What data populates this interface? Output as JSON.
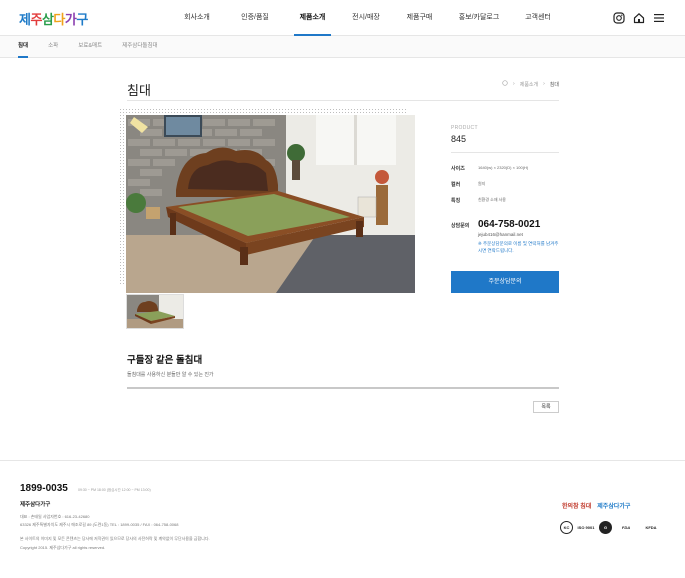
{
  "header": {
    "logo_text": "제주삼다가구",
    "nav": [
      "회사소개",
      "인증/품질",
      "제품소개",
      "전시/매장",
      "제품구매",
      "홍보/카달로그",
      "고객센터"
    ],
    "active_nav": "제품소개",
    "icons": [
      "instagram-icon",
      "home-icon",
      "menu-icon"
    ]
  },
  "subnav": {
    "tabs": [
      "침대",
      "소파",
      "보료&매트",
      "제주삼다돌침대"
    ],
    "active": "침대"
  },
  "page": {
    "title": "침대",
    "breadcrumb": [
      "제품소개",
      "침대"
    ]
  },
  "product": {
    "label": "PRODUCT",
    "code": "845",
    "specs": [
      {
        "key": "사이즈",
        "value": "1640(w) × 2320(D) × 100(H)"
      },
      {
        "key": "컬러",
        "value": "원지"
      },
      {
        "key": "특징",
        "value": "친환경 소재 사용"
      }
    ],
    "consult_label": "상담문의",
    "phone": "064-758-0021",
    "email": "jejub416@hanmail.net",
    "note": "※ 주문상담문의로 이름 및 연락처를 남겨주시면 연락드립니다.",
    "inquiry_button": "주문상담문의"
  },
  "description": {
    "title": "구들장 같은 돌침대",
    "text": "돌침대를 사용하신 분들만 알 수 있는 진가"
  },
  "list_button": "목록",
  "footer": {
    "phone": "1899-0035",
    "hours": "09:30 ~ PM 18:00 (점심시간 12:00 ~ PM 13:00)",
    "company": "제주삼다가구",
    "lines": [
      "대표 : 손태일  사업자번호 : 616-23-42680",
      "63326 제주특별자치도 제주시 애조로길 89 (도련1동)  TEL : 1899-0035 / FAX : 064-758-0068",
      "본 사이트의 이미지 및 모든 콘텐츠는 당사에 저작권이 있으므로 당사의 사전허락 및 계약없이 무단사용을 금합니다.",
      "Copyright 2015. 제주삼다가구 all rights reserved."
    ],
    "logos": [
      "한의참 침대",
      "제주삼다가구"
    ],
    "certs": [
      "KC",
      "ISO 9001",
      "G",
      "FDA",
      "KFDA"
    ]
  }
}
